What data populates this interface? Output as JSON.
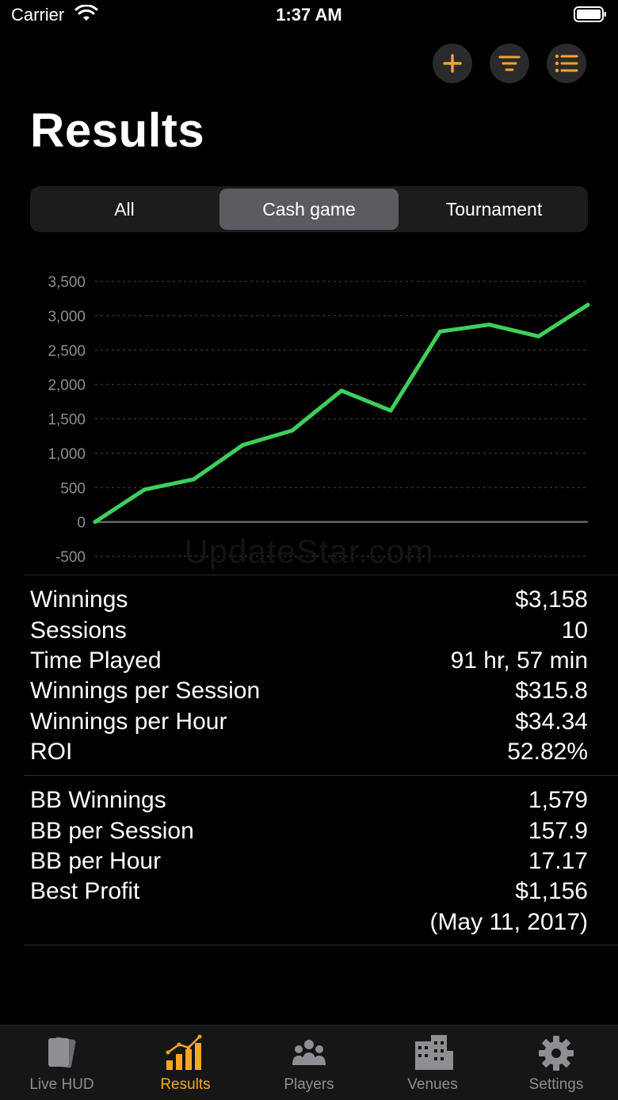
{
  "status_bar": {
    "carrier": "Carrier",
    "time": "1:37 AM"
  },
  "header": {
    "title": "Results",
    "actions": [
      {
        "icon": "plus-icon"
      },
      {
        "icon": "filter-icon"
      },
      {
        "icon": "list-icon"
      }
    ]
  },
  "segments": [
    {
      "label": "All",
      "selected": false
    },
    {
      "label": "Cash game",
      "selected": true
    },
    {
      "label": "Tournament",
      "selected": false
    }
  ],
  "chart_data": {
    "type": "line",
    "x": [
      1,
      2,
      3,
      4,
      5,
      6,
      7,
      8,
      9,
      10,
      11
    ],
    "series": [
      {
        "values": [
          0,
          470,
          620,
          1120,
          1330,
          1910,
          1620,
          2770,
          2870,
          2700,
          3158
        ],
        "color": "#3ecf5c"
      }
    ],
    "yticks": [
      "3,500",
      "3,000",
      "2,500",
      "2,000",
      "1,500",
      "1,000",
      "500",
      "0",
      "-500"
    ],
    "ylim": [
      -500,
      3500
    ],
    "grid": true
  },
  "watermark": "UpdateStar.com",
  "stats_primary": [
    {
      "label": "Winnings",
      "value": "$3,158"
    },
    {
      "label": "Sessions",
      "value": "10"
    },
    {
      "label": "Time Played",
      "value": "91 hr, 57 min"
    },
    {
      "label": "Winnings per Session",
      "value": "$315.8"
    },
    {
      "label": "Winnings per Hour",
      "value": "$34.34"
    },
    {
      "label": "ROI",
      "value": "52.82%"
    }
  ],
  "stats_bb": [
    {
      "label": "BB Winnings",
      "value": "1,579"
    },
    {
      "label": "BB per Session",
      "value": "157.9"
    },
    {
      "label": "BB per Hour",
      "value": "17.17"
    },
    {
      "label": "Best Profit",
      "value": "$1,156"
    },
    {
      "label": "",
      "value": "(May 11, 2017)"
    }
  ],
  "tabs": [
    {
      "label": "Live HUD",
      "icon": "cards-icon",
      "active": false
    },
    {
      "label": "Results",
      "icon": "bar-chart-icon",
      "active": true
    },
    {
      "label": "Players",
      "icon": "people-icon",
      "active": false
    },
    {
      "label": "Venues",
      "icon": "buildings-icon",
      "active": false
    },
    {
      "label": "Settings",
      "icon": "gear-icon",
      "active": false
    }
  ],
  "colors": {
    "accent": "#f5a623",
    "line": "#3ecf5c",
    "background": "#000000"
  }
}
